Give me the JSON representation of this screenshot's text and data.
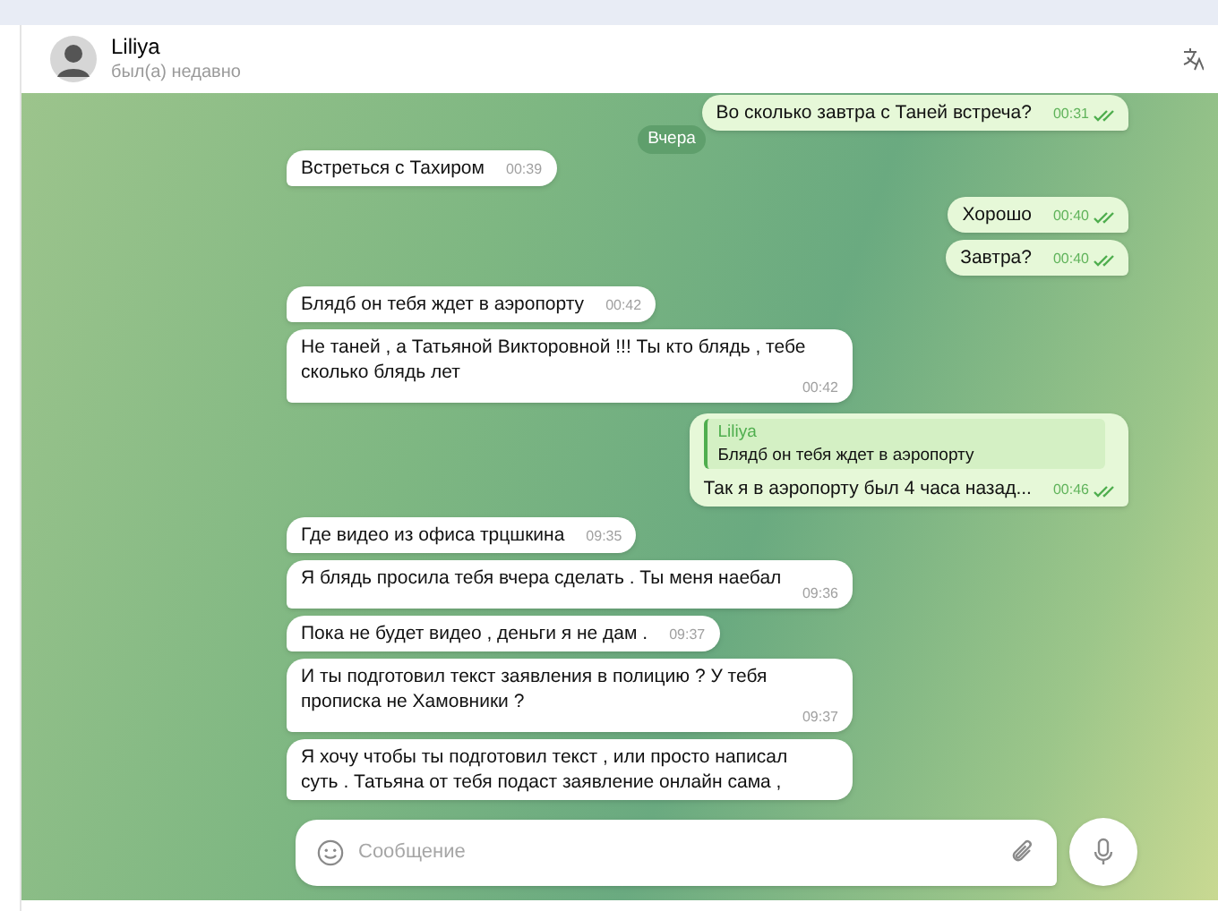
{
  "chat_header": {
    "name": "Liliya",
    "status": "был(а) недавно"
  },
  "date_pill": "Вчера",
  "messages": [
    {
      "kind": "out",
      "text": "Во сколько завтра с Таней встреча?",
      "time": "00:31",
      "read": true
    },
    {
      "kind": "in",
      "text": "Встреться с Тахиром",
      "time": "00:39"
    },
    {
      "kind": "out",
      "text": "Хорошо",
      "time": "00:40",
      "read": true
    },
    {
      "kind": "out",
      "text": "Завтра?",
      "time": "00:40",
      "read": true
    },
    {
      "kind": "in",
      "text": "Блядб он тебя ждет в аэропорту",
      "time": "00:42"
    },
    {
      "kind": "in",
      "text": "Не таней , а Татьяной Викторовной !!! Ты кто блядь , тебе сколько блядь лет",
      "time": "00:42"
    },
    {
      "kind": "out",
      "reply_to": {
        "name": "Liliya",
        "text": "Блядб он тебя ждет в аэропорту"
      },
      "text": "Так я в аэропорту был 4 часа назад...",
      "time": "00:46",
      "read": true
    },
    {
      "kind": "in",
      "text": "Где видео из офиса трцшкина",
      "time": "09:35"
    },
    {
      "kind": "in",
      "text": "Я блядь просила тебя вчера сделать . Ты меня наебал",
      "time": "09:36"
    },
    {
      "kind": "in",
      "text": "Пока не будет видео , деньги я не дам .",
      "time": "09:37"
    },
    {
      "kind": "in",
      "text": "И ты подготовил текст заявления в полицию ? У тебя прописка не Хамовники ?",
      "time": "09:37"
    },
    {
      "kind": "in",
      "text": "Я хочу чтобы ты подготовил текст , или просто написал суть . Татьяна от тебя подаст заявление онлайн сама ,"
    }
  ],
  "composer": {
    "placeholder": "Сообщение"
  }
}
